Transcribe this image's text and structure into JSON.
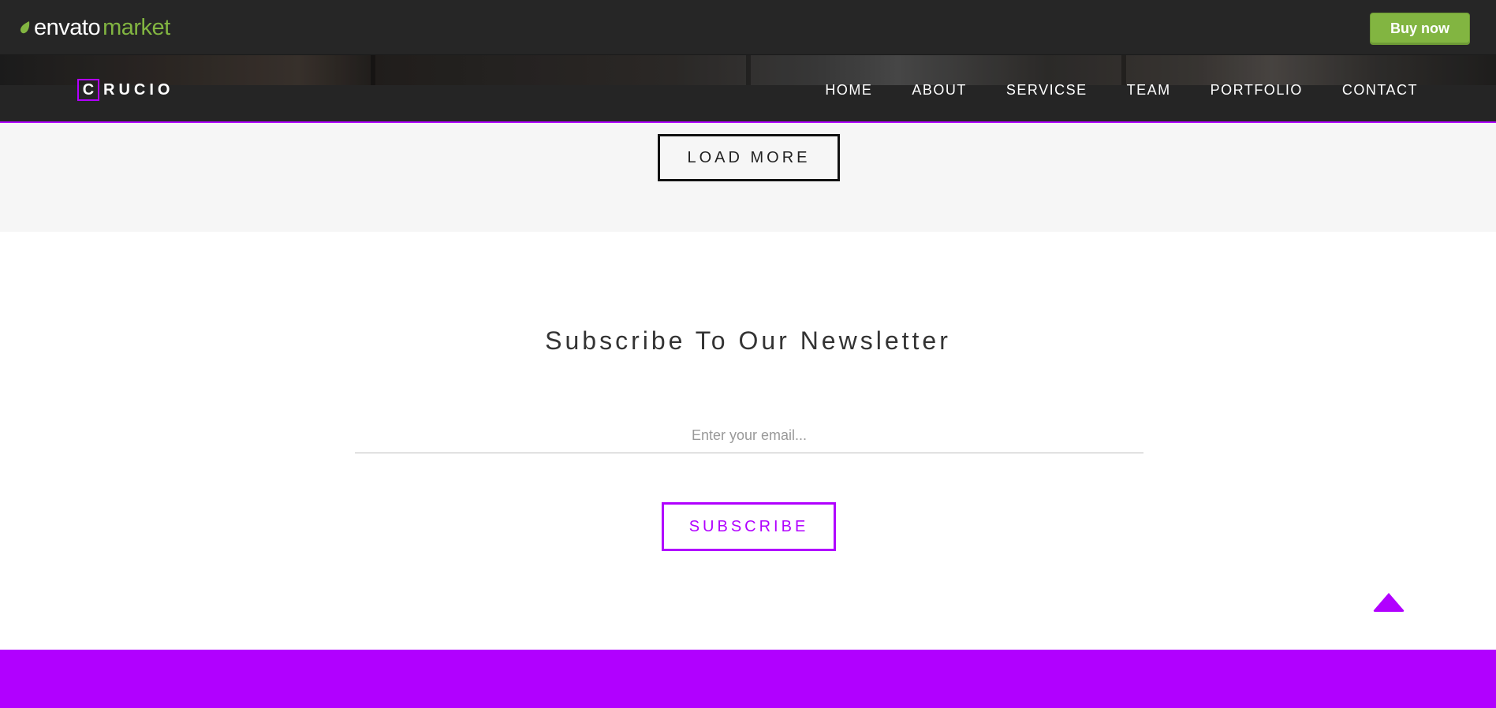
{
  "envato": {
    "logo_word": "envato",
    "logo_market": "market",
    "buy_now": "Buy now",
    "brand_green": "#82b541"
  },
  "header": {
    "logo_initial": "C",
    "logo_rest": "RUCIO",
    "accent": "#b100ff",
    "nav": [
      {
        "label": "HOME"
      },
      {
        "label": "ABOUT"
      },
      {
        "label": "SERVICSE"
      },
      {
        "label": "TEAM"
      },
      {
        "label": "PORTFOLIO"
      },
      {
        "label": "CONTACT"
      }
    ]
  },
  "portfolio": {
    "load_more": "LOAD MORE"
  },
  "newsletter": {
    "title": "Subscribe To Our Newsletter",
    "email_placeholder": "Enter your email...",
    "email_value": "",
    "subscribe_label": "SUBSCRIBE"
  },
  "icons": {
    "scroll_top": "triangle-up-icon",
    "envato_leaf": "leaf-icon"
  }
}
